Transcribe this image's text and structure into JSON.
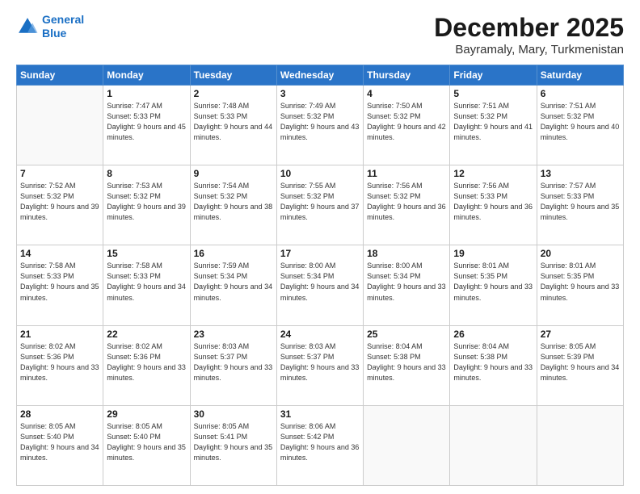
{
  "header": {
    "logo_line1": "General",
    "logo_line2": "Blue",
    "title": "December 2025",
    "subtitle": "Bayramaly, Mary, Turkmenistan"
  },
  "weekdays": [
    "Sunday",
    "Monday",
    "Tuesday",
    "Wednesday",
    "Thursday",
    "Friday",
    "Saturday"
  ],
  "weeks": [
    [
      {
        "day": "",
        "sunrise": "",
        "sunset": "",
        "daylight": ""
      },
      {
        "day": "1",
        "sunrise": "Sunrise: 7:47 AM",
        "sunset": "Sunset: 5:33 PM",
        "daylight": "Daylight: 9 hours and 45 minutes."
      },
      {
        "day": "2",
        "sunrise": "Sunrise: 7:48 AM",
        "sunset": "Sunset: 5:33 PM",
        "daylight": "Daylight: 9 hours and 44 minutes."
      },
      {
        "day": "3",
        "sunrise": "Sunrise: 7:49 AM",
        "sunset": "Sunset: 5:32 PM",
        "daylight": "Daylight: 9 hours and 43 minutes."
      },
      {
        "day": "4",
        "sunrise": "Sunrise: 7:50 AM",
        "sunset": "Sunset: 5:32 PM",
        "daylight": "Daylight: 9 hours and 42 minutes."
      },
      {
        "day": "5",
        "sunrise": "Sunrise: 7:51 AM",
        "sunset": "Sunset: 5:32 PM",
        "daylight": "Daylight: 9 hours and 41 minutes."
      },
      {
        "day": "6",
        "sunrise": "Sunrise: 7:51 AM",
        "sunset": "Sunset: 5:32 PM",
        "daylight": "Daylight: 9 hours and 40 minutes."
      }
    ],
    [
      {
        "day": "7",
        "sunrise": "Sunrise: 7:52 AM",
        "sunset": "Sunset: 5:32 PM",
        "daylight": "Daylight: 9 hours and 39 minutes."
      },
      {
        "day": "8",
        "sunrise": "Sunrise: 7:53 AM",
        "sunset": "Sunset: 5:32 PM",
        "daylight": "Daylight: 9 hours and 39 minutes."
      },
      {
        "day": "9",
        "sunrise": "Sunrise: 7:54 AM",
        "sunset": "Sunset: 5:32 PM",
        "daylight": "Daylight: 9 hours and 38 minutes."
      },
      {
        "day": "10",
        "sunrise": "Sunrise: 7:55 AM",
        "sunset": "Sunset: 5:32 PM",
        "daylight": "Daylight: 9 hours and 37 minutes."
      },
      {
        "day": "11",
        "sunrise": "Sunrise: 7:56 AM",
        "sunset": "Sunset: 5:32 PM",
        "daylight": "Daylight: 9 hours and 36 minutes."
      },
      {
        "day": "12",
        "sunrise": "Sunrise: 7:56 AM",
        "sunset": "Sunset: 5:33 PM",
        "daylight": "Daylight: 9 hours and 36 minutes."
      },
      {
        "day": "13",
        "sunrise": "Sunrise: 7:57 AM",
        "sunset": "Sunset: 5:33 PM",
        "daylight": "Daylight: 9 hours and 35 minutes."
      }
    ],
    [
      {
        "day": "14",
        "sunrise": "Sunrise: 7:58 AM",
        "sunset": "Sunset: 5:33 PM",
        "daylight": "Daylight: 9 hours and 35 minutes."
      },
      {
        "day": "15",
        "sunrise": "Sunrise: 7:58 AM",
        "sunset": "Sunset: 5:33 PM",
        "daylight": "Daylight: 9 hours and 34 minutes."
      },
      {
        "day": "16",
        "sunrise": "Sunrise: 7:59 AM",
        "sunset": "Sunset: 5:34 PM",
        "daylight": "Daylight: 9 hours and 34 minutes."
      },
      {
        "day": "17",
        "sunrise": "Sunrise: 8:00 AM",
        "sunset": "Sunset: 5:34 PM",
        "daylight": "Daylight: 9 hours and 34 minutes."
      },
      {
        "day": "18",
        "sunrise": "Sunrise: 8:00 AM",
        "sunset": "Sunset: 5:34 PM",
        "daylight": "Daylight: 9 hours and 33 minutes."
      },
      {
        "day": "19",
        "sunrise": "Sunrise: 8:01 AM",
        "sunset": "Sunset: 5:35 PM",
        "daylight": "Daylight: 9 hours and 33 minutes."
      },
      {
        "day": "20",
        "sunrise": "Sunrise: 8:01 AM",
        "sunset": "Sunset: 5:35 PM",
        "daylight": "Daylight: 9 hours and 33 minutes."
      }
    ],
    [
      {
        "day": "21",
        "sunrise": "Sunrise: 8:02 AM",
        "sunset": "Sunset: 5:36 PM",
        "daylight": "Daylight: 9 hours and 33 minutes."
      },
      {
        "day": "22",
        "sunrise": "Sunrise: 8:02 AM",
        "sunset": "Sunset: 5:36 PM",
        "daylight": "Daylight: 9 hours and 33 minutes."
      },
      {
        "day": "23",
        "sunrise": "Sunrise: 8:03 AM",
        "sunset": "Sunset: 5:37 PM",
        "daylight": "Daylight: 9 hours and 33 minutes."
      },
      {
        "day": "24",
        "sunrise": "Sunrise: 8:03 AM",
        "sunset": "Sunset: 5:37 PM",
        "daylight": "Daylight: 9 hours and 33 minutes."
      },
      {
        "day": "25",
        "sunrise": "Sunrise: 8:04 AM",
        "sunset": "Sunset: 5:38 PM",
        "daylight": "Daylight: 9 hours and 33 minutes."
      },
      {
        "day": "26",
        "sunrise": "Sunrise: 8:04 AM",
        "sunset": "Sunset: 5:38 PM",
        "daylight": "Daylight: 9 hours and 33 minutes."
      },
      {
        "day": "27",
        "sunrise": "Sunrise: 8:05 AM",
        "sunset": "Sunset: 5:39 PM",
        "daylight": "Daylight: 9 hours and 34 minutes."
      }
    ],
    [
      {
        "day": "28",
        "sunrise": "Sunrise: 8:05 AM",
        "sunset": "Sunset: 5:40 PM",
        "daylight": "Daylight: 9 hours and 34 minutes."
      },
      {
        "day": "29",
        "sunrise": "Sunrise: 8:05 AM",
        "sunset": "Sunset: 5:40 PM",
        "daylight": "Daylight: 9 hours and 35 minutes."
      },
      {
        "day": "30",
        "sunrise": "Sunrise: 8:05 AM",
        "sunset": "Sunset: 5:41 PM",
        "daylight": "Daylight: 9 hours and 35 minutes."
      },
      {
        "day": "31",
        "sunrise": "Sunrise: 8:06 AM",
        "sunset": "Sunset: 5:42 PM",
        "daylight": "Daylight: 9 hours and 36 minutes."
      },
      {
        "day": "",
        "sunrise": "",
        "sunset": "",
        "daylight": ""
      },
      {
        "day": "",
        "sunrise": "",
        "sunset": "",
        "daylight": ""
      },
      {
        "day": "",
        "sunrise": "",
        "sunset": "",
        "daylight": ""
      }
    ]
  ]
}
